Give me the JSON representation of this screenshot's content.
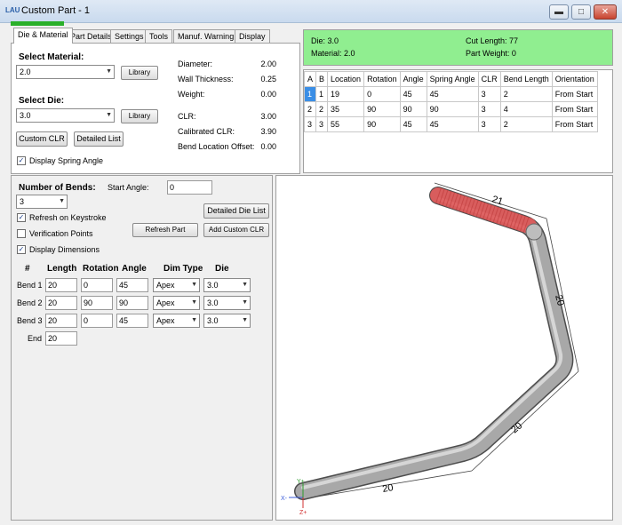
{
  "window": {
    "title": "Custom Part - 1",
    "icon_text": "LAU"
  },
  "tabs": [
    "Die & Material",
    "Part Details",
    "Settings",
    "Tools",
    "Manuf. Warning",
    "Display"
  ],
  "material": {
    "section_label": "Select Material:",
    "selected": "2.0",
    "library_label": "Library"
  },
  "die": {
    "section_label": "Select Die:",
    "selected": "3.0",
    "library_label": "Library"
  },
  "buttons": {
    "custom_clr": "Custom CLR",
    "detailed_list": "Detailed List",
    "detailed_die_list": "Detailed Die List",
    "refresh_part": "Refresh Part",
    "add_custom_clr": "Add Custom CLR"
  },
  "display_spring_angle": {
    "label": "Display Spring Angle",
    "checked": true
  },
  "properties": [
    {
      "label": "Diameter:",
      "value": "2.00"
    },
    {
      "label": "Wall Thickness:",
      "value": "0.25"
    },
    {
      "label": "Weight:",
      "value": "0.00"
    },
    {
      "label": "CLR:",
      "value": "3.00"
    },
    {
      "label": "Calibrated CLR:",
      "value": "3.90"
    },
    {
      "label": "Bend Location Offset:",
      "value": "0.00"
    }
  ],
  "info": {
    "die": "Die: 3.0",
    "material": "Material: 2.0",
    "cut_length": "Cut Length: 77",
    "part_weight": "Part Weight: 0"
  },
  "table": {
    "headers": [
      "A",
      "B",
      "Location",
      "Rotation",
      "Angle",
      "Spring Angle",
      "CLR",
      "Bend Length",
      "Orientation"
    ],
    "rows": [
      [
        "1",
        "1",
        "19",
        "0",
        "45",
        "45",
        "3",
        "2",
        "From Start"
      ],
      [
        "2",
        "2",
        "35",
        "90",
        "90",
        "90",
        "3",
        "4",
        "From Start"
      ],
      [
        "3",
        "3",
        "55",
        "90",
        "45",
        "45",
        "3",
        "2",
        "From Start"
      ]
    ]
  },
  "bends_panel": {
    "number_label": "Number of Bends:",
    "number_value": "3",
    "start_angle_label": "Start Angle:",
    "start_angle_value": "0",
    "refresh_keystroke": {
      "label": "Refresh on Keystroke",
      "checked": true
    },
    "verification_points": {
      "label": "Verification Points",
      "checked": false
    },
    "display_dimensions": {
      "label": "Display Dimensions",
      "checked": true
    },
    "columns": [
      "#",
      "Length",
      "Rotation",
      "Angle",
      "Dim Type",
      "Die"
    ],
    "bends": [
      {
        "name": "Bend 1",
        "length": "20",
        "rotation": "0",
        "angle": "45",
        "dim_type": "Apex",
        "die": "3.0"
      },
      {
        "name": "Bend 2",
        "length": "20",
        "rotation": "90",
        "angle": "90",
        "dim_type": "Apex",
        "die": "3.0"
      },
      {
        "name": "Bend 3",
        "length": "20",
        "rotation": "0",
        "angle": "45",
        "dim_type": "Apex",
        "die": "3.0"
      }
    ],
    "end": {
      "name": "End",
      "length": "20"
    }
  },
  "viewport": {
    "dimensions": [
      "21",
      "20",
      "20",
      "20"
    ],
    "axis_labels": {
      "x": "X-",
      "y": "Y+",
      "z": "Z+"
    },
    "colors": {
      "tube": "#9a9a9a",
      "highlight": "#e05050"
    }
  }
}
